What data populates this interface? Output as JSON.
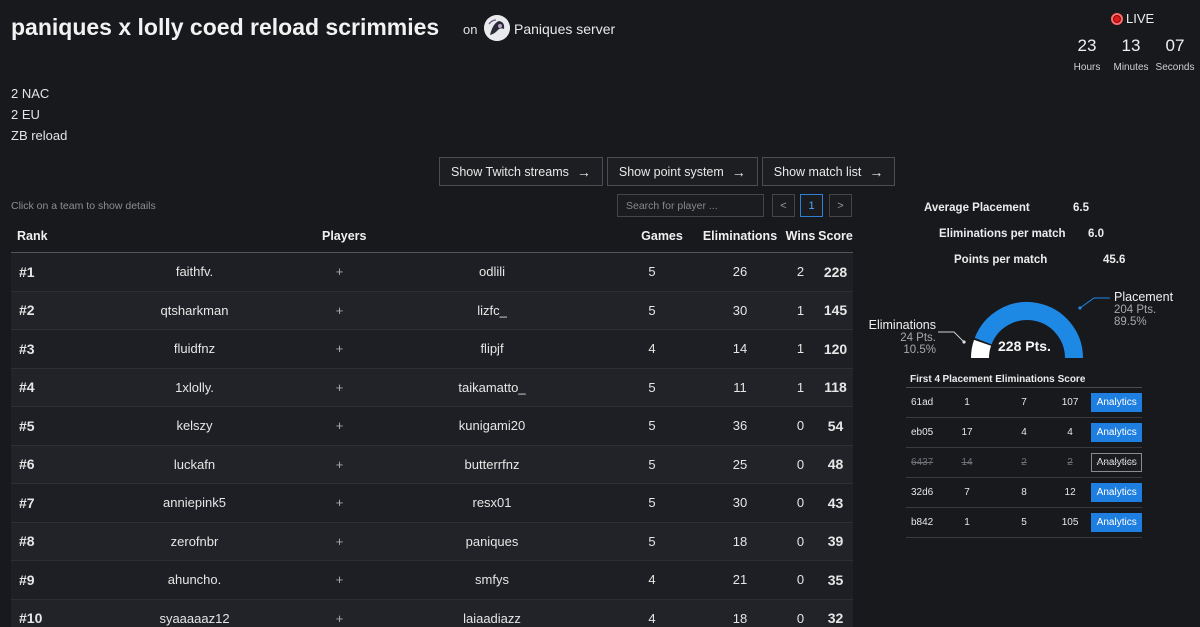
{
  "header": {
    "title": "paniques x lolly coed reload scrimmies",
    "on_label": "on",
    "server_name": "Paniques server"
  },
  "live": {
    "label": "LIVE",
    "hours": "23",
    "hours_label": "Hours",
    "minutes": "13",
    "minutes_label": "Minutes",
    "seconds": "07",
    "seconds_label": "Seconds"
  },
  "description": [
    "2 NAC",
    "2 EU",
    "ZB reload"
  ],
  "buttons": {
    "twitch": "Show Twitch streams",
    "points": "Show point system",
    "matches": "Show match list"
  },
  "hint": "Click on a team to show details",
  "search": {
    "placeholder": "Search for player ..."
  },
  "pagination": {
    "prev": "<",
    "page": "1",
    "next": ">"
  },
  "table": {
    "headers": {
      "rank": "Rank",
      "players": "Players",
      "games": "Games",
      "eliminations": "Eliminations",
      "wins": "Wins",
      "score": "Score"
    },
    "rows": [
      {
        "rank": "#1",
        "p1": "faithfv.",
        "plus": "+",
        "p2": "odlili",
        "games": "5",
        "elims": "26",
        "wins": "2",
        "score": "228"
      },
      {
        "rank": "#2",
        "p1": "qtsharkman",
        "plus": "+",
        "p2": "lizfc_",
        "games": "5",
        "elims": "30",
        "wins": "1",
        "score": "145"
      },
      {
        "rank": "#3",
        "p1": "fluidfnz",
        "plus": "+",
        "p2": "flipjf",
        "games": "4",
        "elims": "14",
        "wins": "1",
        "score": "120"
      },
      {
        "rank": "#4",
        "p1": "1xlolly.",
        "plus": "+",
        "p2": "taikamatto_",
        "games": "5",
        "elims": "11",
        "wins": "1",
        "score": "118"
      },
      {
        "rank": "#5",
        "p1": "kelszy",
        "plus": "+",
        "p2": "kunigami20",
        "games": "5",
        "elims": "36",
        "wins": "0",
        "score": "54"
      },
      {
        "rank": "#6",
        "p1": "luckafn",
        "plus": "+",
        "p2": "butterrfnz",
        "games": "5",
        "elims": "25",
        "wins": "0",
        "score": "48"
      },
      {
        "rank": "#7",
        "p1": "anniepink5",
        "plus": "+",
        "p2": "resx01",
        "games": "5",
        "elims": "30",
        "wins": "0",
        "score": "43"
      },
      {
        "rank": "#8",
        "p1": "zerofnbr",
        "plus": "+",
        "p2": "paniques",
        "games": "5",
        "elims": "18",
        "wins": "0",
        "score": "39"
      },
      {
        "rank": "#9",
        "p1": "ahuncho.",
        "plus": "+",
        "p2": "smfys",
        "games": "4",
        "elims": "21",
        "wins": "0",
        "score": "35"
      },
      {
        "rank": "#10",
        "p1": "syaaaaaz12",
        "plus": "+",
        "p2": "laiaadiazz",
        "games": "4",
        "elims": "18",
        "wins": "0",
        "score": "32"
      }
    ]
  },
  "team_stats": {
    "avg_placement_label": "Average Placement",
    "avg_placement": "6.5",
    "elims_per_match_label": "Eliminations per match",
    "elims_per_match": "6.0",
    "points_per_match_label": "Points per match",
    "points_per_match": "45.6"
  },
  "gauge": {
    "total": "228 Pts.",
    "elim_label": "Eliminations",
    "elim_pts": "24 Pts.",
    "elim_pct": "10.5%",
    "elim_fraction": 0.105,
    "place_label": "Placement",
    "place_pts": "204 Pts.",
    "place_pct": "89.5%",
    "place_fraction": 0.895,
    "colors": {
      "placement": "#1e88e5",
      "eliminations": "#ffffff"
    }
  },
  "matches": {
    "headers": {
      "id": "First 4",
      "placement": "Placement",
      "eliminations": "Eliminations",
      "score": "Score"
    },
    "rows": [
      {
        "id": "61ad",
        "placement": "1",
        "eliminations": "7",
        "score": "107",
        "button": "Analytics",
        "struck": false
      },
      {
        "id": "eb05",
        "placement": "17",
        "eliminations": "4",
        "score": "4",
        "button": "Analytics",
        "struck": false
      },
      {
        "id": "6437",
        "placement": "14",
        "eliminations": "2",
        "score": "2",
        "button": "Analytics",
        "struck": true
      },
      {
        "id": "32d6",
        "placement": "7",
        "eliminations": "8",
        "score": "12",
        "button": "Analytics",
        "struck": false
      },
      {
        "id": "b842",
        "placement": "1",
        "eliminations": "5",
        "score": "105",
        "button": "Analytics",
        "struck": false
      }
    ]
  }
}
